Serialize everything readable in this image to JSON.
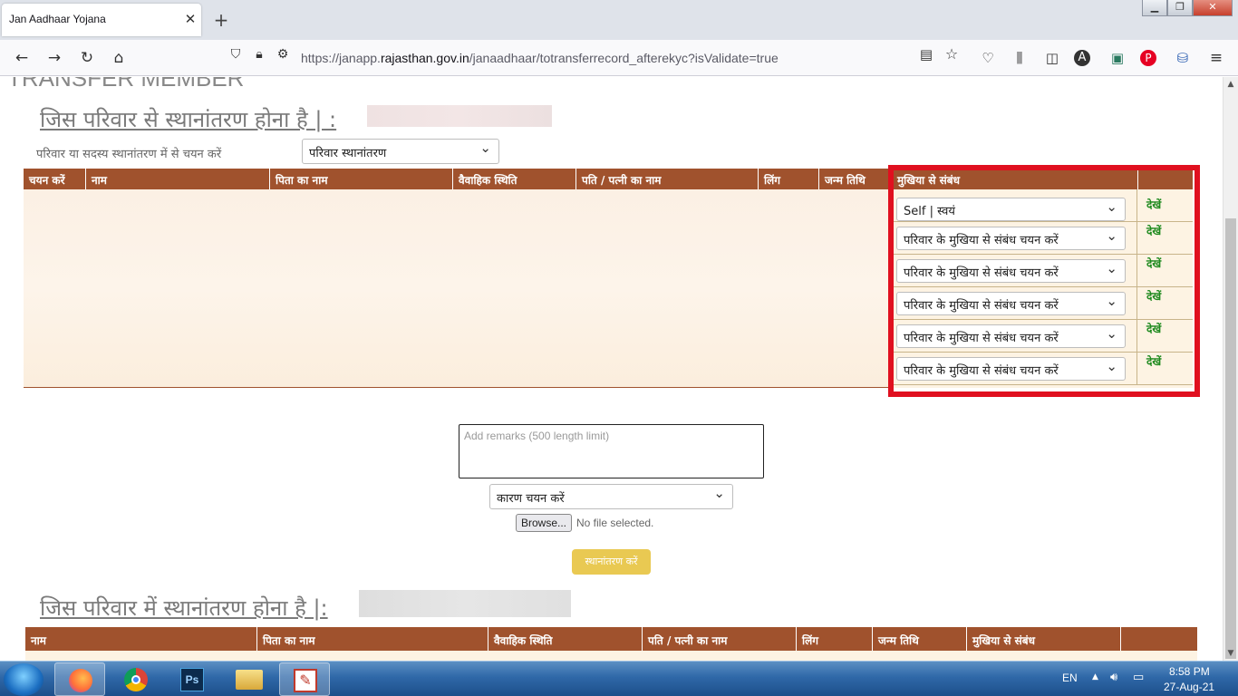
{
  "browser": {
    "tab_title": "Jan Aadhaar Yojana",
    "tab_close": "✕",
    "new_tab": "+",
    "url_prefix": "https://janapp.",
    "url_domain": "rajasthan.gov.in",
    "url_path": "/janaadhaar/totransferrecord_afterekyc?isValidate=true"
  },
  "page": {
    "cut_heading": "TRANSFER MEMBER",
    "from_family_title": "जिस परिवार से स्थानांतरण होना है |  :",
    "choose_label": "परिवार या सदस्य स्थानांतरण में से चयन करें",
    "transfer_type_value": "परिवार स्थानांतरण",
    "members_table": {
      "headers": [
        "चयन करें",
        "नाम",
        "पिता का नाम",
        "वैवाहिक स्थिति",
        "पति / पत्नी का नाम",
        "लिंग",
        "जन्म तिथि",
        "मुखिया से संबंध"
      ],
      "relation_values": [
        "Self | स्वयं",
        "परिवार के मुखिया से संबंध चयन करें",
        "परिवार के मुखिया से संबंध चयन करें",
        "परिवार के मुखिया से संबंध चयन करें",
        "परिवार के मुखिया से संबंध चयन करें",
        "परिवार के मुखिया से संबंध चयन करें"
      ],
      "view_label": "देखें"
    },
    "remarks_placeholder": "Add remarks (500 length limit)",
    "reason_select_value": "कारण चयन करें",
    "browse_label": "Browse...",
    "no_file_text": "No file selected.",
    "transfer_button": "स्थानांतरण करें",
    "to_family_title": "जिस परिवार में स्थानांतरण होना है |:",
    "target_table": {
      "headers": [
        "नाम",
        "पिता का नाम",
        "वैवाहिक स्थिति",
        "पति / पत्नी का नाम",
        "लिंग",
        "जन्म तिथि",
        "मुखिया से संबंध"
      ]
    }
  },
  "taskbar": {
    "language": "EN",
    "time": "8:58 PM",
    "date": "27-Aug-21"
  }
}
